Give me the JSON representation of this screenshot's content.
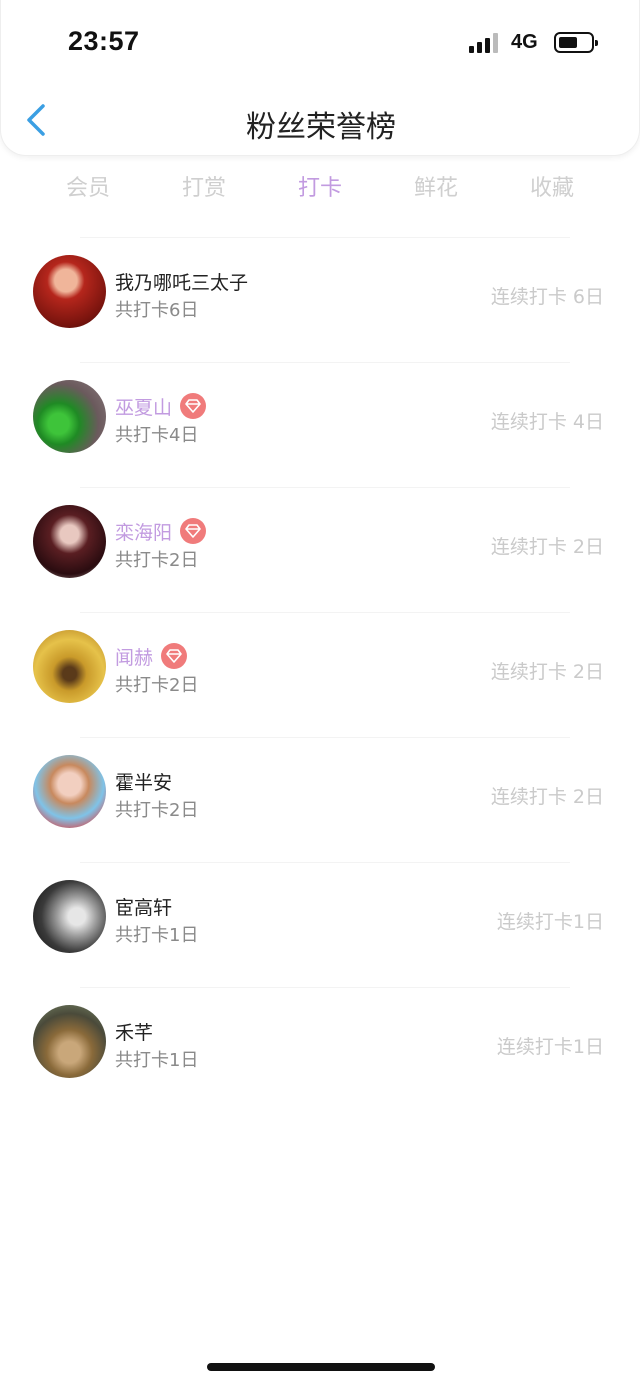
{
  "status_bar": {
    "time": "23:57",
    "network": "4G",
    "icons": [
      "signal-icon",
      "battery-icon"
    ]
  },
  "nav": {
    "title": "粉丝荣誉榜",
    "back_icon": "chevron-left-icon"
  },
  "tabs": [
    {
      "label": "会员",
      "active": false
    },
    {
      "label": "打赏",
      "active": false
    },
    {
      "label": "打卡",
      "active": true
    },
    {
      "label": "鲜花",
      "active": false
    },
    {
      "label": "收藏",
      "active": false
    }
  ],
  "colors": {
    "accent": "#c29be0",
    "vip_badge": "#f07b7b",
    "back_arrow": "#3b9fe3",
    "muted": "#cacaca"
  },
  "fans": [
    {
      "name": "我乃哪吒三太子",
      "vip": false,
      "total": "共打卡6日",
      "streak": "连续打卡 6日"
    },
    {
      "name": "巫夏山",
      "vip": true,
      "total": "共打卡4日",
      "streak": "连续打卡 4日"
    },
    {
      "name": "栾海阳",
      "vip": true,
      "total": "共打卡2日",
      "streak": "连续打卡 2日"
    },
    {
      "name": "闻赫",
      "vip": true,
      "total": "共打卡2日",
      "streak": "连续打卡 2日"
    },
    {
      "name": "霍半安",
      "vip": false,
      "total": "共打卡2日",
      "streak": "连续打卡 2日"
    },
    {
      "name": "宦高轩",
      "vip": false,
      "total": "共打卡1日",
      "streak": "连续打卡1日"
    },
    {
      "name": "禾芊",
      "vip": false,
      "total": "共打卡1日",
      "streak": "连续打卡1日"
    }
  ]
}
